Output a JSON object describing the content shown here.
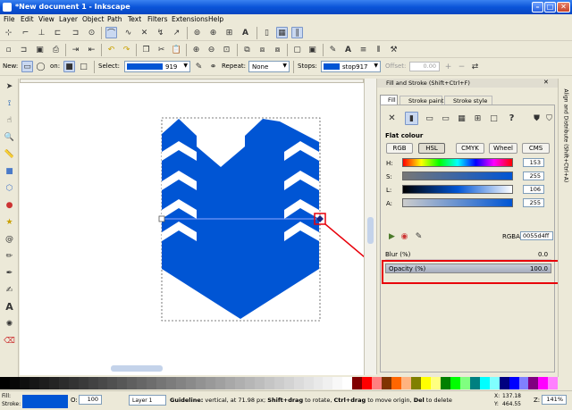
{
  "window": {
    "title": "*New document 1 - Inkscape"
  },
  "menu": [
    "File",
    "Edit",
    "View",
    "Layer",
    "Object",
    "Path",
    "Text",
    "Filters",
    "Extensions",
    "Help"
  ],
  "toolctrl": {
    "new_label": "New:",
    "on_label": "on:",
    "select_label": "Select:",
    "select_value": "919",
    "repeat_label": "Repeat:",
    "repeat_value": "None",
    "stops_label": "Stops:",
    "stops_value": "stop917",
    "offset_label": "Offset:",
    "offset_value": "0.00"
  },
  "dialog": {
    "title": "Fill and Stroke (Shift+Ctrl+F)",
    "side_tab": "Align and Distribute (Shift+Ctrl+A)",
    "tabs": [
      "Fill",
      "Stroke paint",
      "Stroke style"
    ],
    "section_title": "Flat colour",
    "mode_buttons": [
      "RGB",
      "HSL",
      "CMYK",
      "Wheel",
      "CMS"
    ],
    "channels": [
      {
        "label": "H:",
        "value": "153"
      },
      {
        "label": "S:",
        "value": "255"
      },
      {
        "label": "L:",
        "value": "106"
      },
      {
        "label": "A:",
        "value": "255"
      }
    ],
    "rgba_label": "RGBA:",
    "rgba_value": "0055d4ff",
    "blur_label": "Blur (%)",
    "blur_value": "0.0",
    "opacity_label": "Opacity (%)",
    "opacity_value": "100.0"
  },
  "status": {
    "fill_label": "Fill:",
    "stroke_label": "Stroke:",
    "fill_color": "#0055d4",
    "o_label": "O:",
    "o_value": "100",
    "layer": "Layer 1",
    "message_bold": "Guideline:",
    "message_1": " vertical, at 71.98 px; ",
    "message_bold2": "Shift+drag",
    "message_2": " to rotate, ",
    "message_bold3": "Ctrl+drag",
    "message_3": " to move origin, ",
    "message_bold4": "Del",
    "message_4": " to delete",
    "x_label": "X:",
    "x_value": "137.18",
    "y_label": "Y:",
    "y_value": "464.55",
    "z_label": "Z:",
    "zoom": "141%"
  },
  "colors": {
    "shape": "#0055d4",
    "annotation": "#e8000a",
    "guide": "#8fa7ff"
  }
}
